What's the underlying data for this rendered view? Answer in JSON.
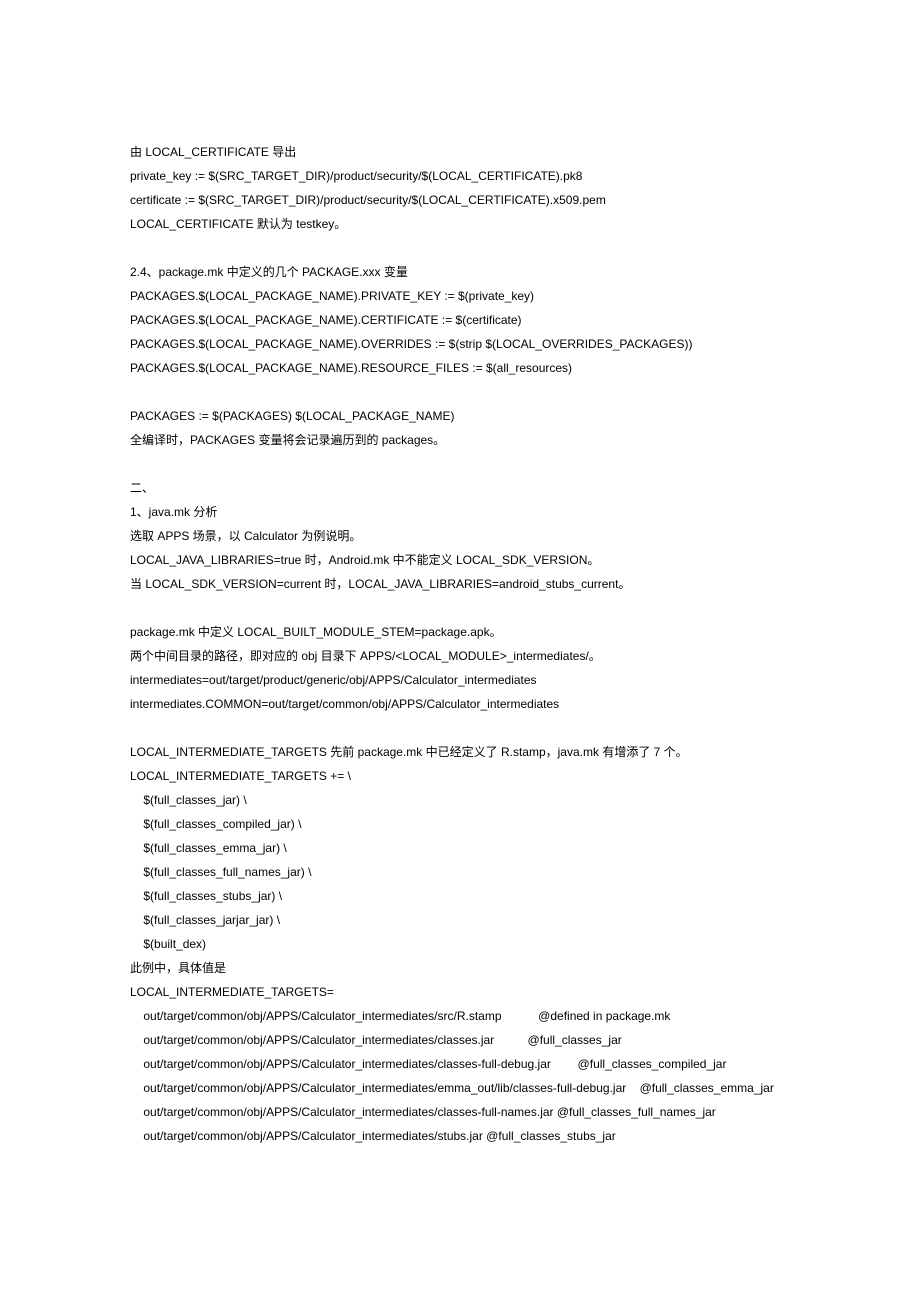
{
  "lines": [
    "由 LOCAL_CERTIFICATE 导出",
    "private_key := $(SRC_TARGET_DIR)/product/security/$(LOCAL_CERTIFICATE).pk8",
    "certificate := $(SRC_TARGET_DIR)/product/security/$(LOCAL_CERTIFICATE).x509.pem",
    "LOCAL_CERTIFICATE 默认为 testkey。",
    "",
    "2.4、package.mk 中定义的几个 PACKAGE.xxx 变量",
    "PACKAGES.$(LOCAL_PACKAGE_NAME).PRIVATE_KEY := $(private_key)",
    "PACKAGES.$(LOCAL_PACKAGE_NAME).CERTIFICATE := $(certificate)",
    "PACKAGES.$(LOCAL_PACKAGE_NAME).OVERRIDES := $(strip $(LOCAL_OVERRIDES_PACKAGES))",
    "PACKAGES.$(LOCAL_PACKAGE_NAME).RESOURCE_FILES := $(all_resources)",
    "",
    "PACKAGES := $(PACKAGES) $(LOCAL_PACKAGE_NAME)",
    "全编译时，PACKAGES 变量将会记录遍历到的 packages。",
    "",
    "二、",
    "1、java.mk 分析",
    "选取 APPS 场景，以 Calculator 为例说明。",
    "LOCAL_JAVA_LIBRARIES=true 时，Android.mk 中不能定义 LOCAL_SDK_VERSION。",
    "当 LOCAL_SDK_VERSION=current 时，LOCAL_JAVA_LIBRARIES=android_stubs_current。",
    "",
    "package.mk 中定义 LOCAL_BUILT_MODULE_STEM=package.apk。",
    "两个中间目录的路径，即对应的 obj 目录下 APPS/<LOCAL_MODULE>_intermediates/。",
    "intermediates=out/target/product/generic/obj/APPS/Calculator_intermediates",
    "intermediates.COMMON=out/target/common/obj/APPS/Calculator_intermediates",
    "",
    "LOCAL_INTERMEDIATE_TARGETS 先前 package.mk 中已经定义了 R.stamp，java.mk 有增添了 7 个。",
    "LOCAL_INTERMEDIATE_TARGETS += \\",
    "    $(full_classes_jar) \\",
    "    $(full_classes_compiled_jar) \\",
    "    $(full_classes_emma_jar) \\",
    "    $(full_classes_full_names_jar) \\",
    "    $(full_classes_stubs_jar) \\",
    "    $(full_classes_jarjar_jar) \\",
    "    $(built_dex)",
    "此例中，具体值是",
    "LOCAL_INTERMEDIATE_TARGETS=",
    "    out/target/common/obj/APPS/Calculator_intermediates/src/R.stamp           @defined in package.mk",
    "    out/target/common/obj/APPS/Calculator_intermediates/classes.jar          @full_classes_jar",
    "    out/target/common/obj/APPS/Calculator_intermediates/classes-full-debug.jar        @full_classes_compiled_jar",
    "    out/target/common/obj/APPS/Calculator_intermediates/emma_out/lib/classes-full-debug.jar    @full_classes_emma_jar",
    "    out/target/common/obj/APPS/Calculator_intermediates/classes-full-names.jar @full_classes_full_names_jar",
    "    out/target/common/obj/APPS/Calculator_intermediates/stubs.jar @full_classes_stubs_jar"
  ]
}
